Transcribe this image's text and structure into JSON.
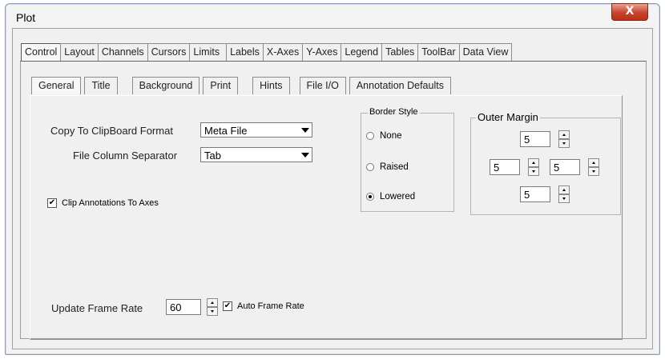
{
  "window": {
    "title": "Plot",
    "close_glyph": "X"
  },
  "tabs": [
    "Control",
    "Layout",
    "Channels",
    "Cursors",
    "Limits",
    "Labels",
    "X-Axes",
    "Y-Axes",
    "Legend",
    "Tables",
    "ToolBar",
    "Data View"
  ],
  "subtabs": [
    "General",
    "Title",
    "Background",
    "Print",
    "Hints",
    "File I/O",
    "Annotation Defaults"
  ],
  "general": {
    "clipboard_label": "Copy To ClipBoard Format",
    "clipboard_value": "Meta File",
    "separator_label": "File Column Separator",
    "separator_value": "Tab",
    "clip_annotations_label": "Clip Annotations To Axes",
    "clip_annotations_checked": "✔",
    "update_rate_label": "Update Frame Rate",
    "update_rate_value": "60",
    "auto_frame_label": "Auto Frame Rate",
    "auto_frame_checked": "✔"
  },
  "border_style": {
    "title": "Border Style",
    "options": [
      "None",
      "Raised",
      "Lowered"
    ],
    "selected": "Lowered"
  },
  "outer_margin": {
    "title": "Outer Margin",
    "top": "5",
    "left": "5",
    "right": "5",
    "bottom": "5"
  },
  "icons": {
    "close": "close-icon",
    "dropdown": "chevron-down-icon",
    "spin": "spin-arrows-icon",
    "check": "checkmark-icon"
  }
}
